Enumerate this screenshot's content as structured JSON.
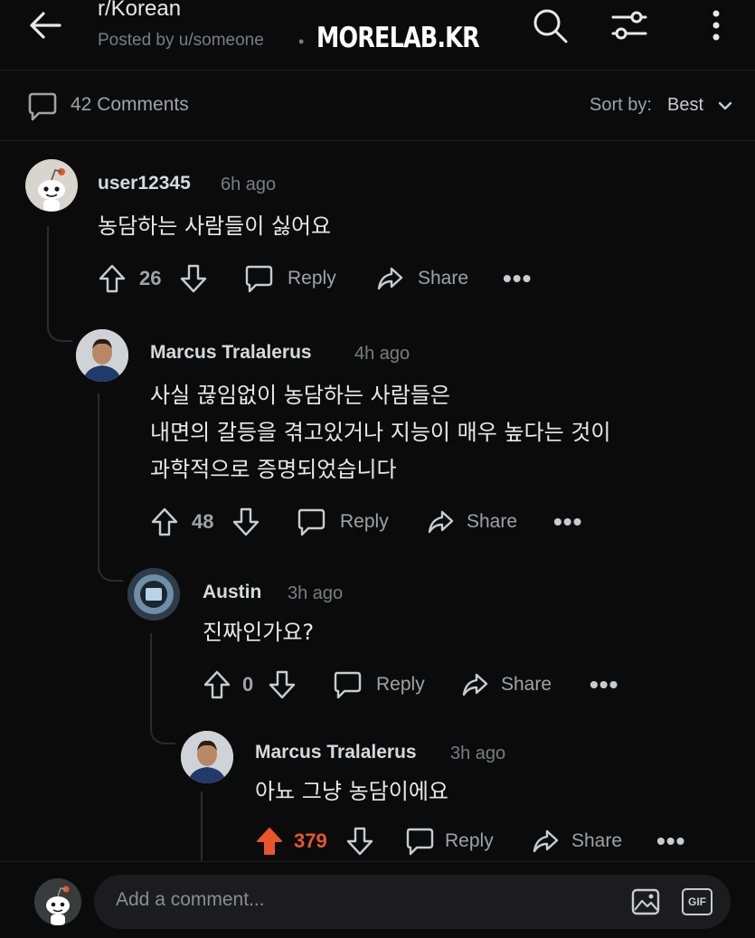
{
  "header": {
    "subreddit": "r/Korean",
    "posted_by": "Posted by u/someone",
    "separator": "•",
    "watermark": "MORELAB.KR"
  },
  "comments_bar": {
    "count_label": "42 Comments",
    "sort_label": "Sort by:",
    "sort_value": "Best"
  },
  "comments": [
    {
      "username": "user12345",
      "time": "6h ago",
      "lines": [
        "농담하는 사람들이 싫어요"
      ],
      "votes": "26",
      "reply": "Reply",
      "share": "Share",
      "more": "•••"
    },
    {
      "username": "Marcus Tralalerus",
      "time": "4h ago",
      "lines": [
        "사실 끊임없이 농담하는 사람들은",
        "내면의 갈등을 겪고있거나 지능이 매우 높다는 것이",
        "과학적으로 증명되었습니다"
      ],
      "votes": "48",
      "reply": "Reply",
      "share": "Share",
      "more": "•••"
    },
    {
      "username": "Austin",
      "time": "3h ago",
      "lines": [
        "진짜인가요?"
      ],
      "votes": "0",
      "reply": "Reply",
      "share": "Share",
      "more": "•••"
    },
    {
      "username": "Marcus Tralalerus",
      "time": "3h ago",
      "lines": [
        "아뇨 그냥 농담이에요"
      ],
      "votes": "379",
      "reply": "Reply",
      "share": "Share",
      "more": "•••"
    }
  ],
  "bottom_bar": {
    "placeholder": "Add a comment...",
    "gif_label": "GIF"
  },
  "colors": {
    "background": "#0b0b0c",
    "upvote_active": "#e8562a",
    "muted_text": "#9ea3a6"
  },
  "icons": [
    "back-arrow-icon",
    "search-icon",
    "filter-icon",
    "more-vertical-icon",
    "comment-bubble-icon",
    "chevron-down-icon",
    "upvote-icon",
    "downvote-icon",
    "reply-icon",
    "share-icon",
    "image-icon",
    "gif-icon"
  ]
}
